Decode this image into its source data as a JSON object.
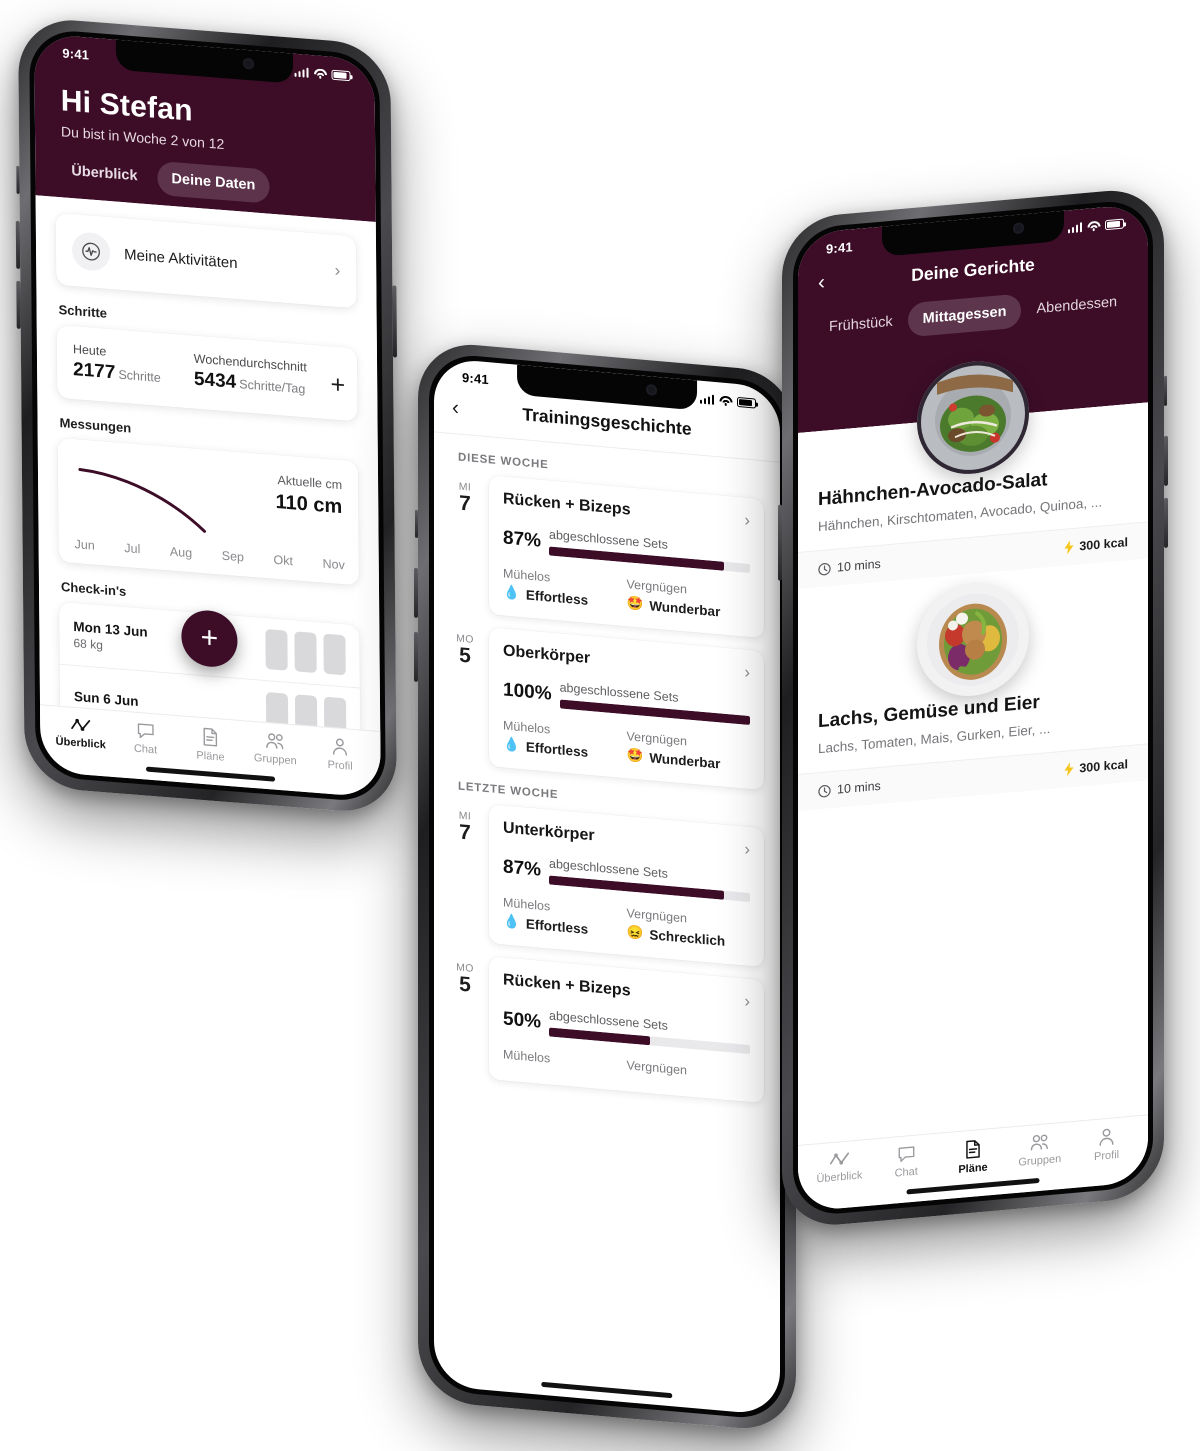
{
  "phone1": {
    "status": {
      "time": "9:41",
      "cellular": "signal-bars",
      "wifi": "wifi-icon",
      "battery": "battery-icon"
    },
    "hero": {
      "greeting": "Hi Stefan",
      "subtitle": "Du bist in Woche 2 von 12",
      "tabs": [
        {
          "label": "Überblick",
          "active": false
        },
        {
          "label": "Deine Daten",
          "active": true
        }
      ]
    },
    "activities": {
      "label": "Meine Aktivitäten",
      "icon": "activity-pulse-icon",
      "chevron": "›"
    },
    "steps": {
      "section_title": "Schritte",
      "today_label": "Heute",
      "today_value": "2177",
      "today_unit": "Schritte",
      "avg_label": "Wochendurchschnitt",
      "avg_value": "5434",
      "avg_unit": "Schritte/Tag",
      "add": "+"
    },
    "measurements": {
      "section_title": "Messungen",
      "current_label": "Aktuelle cm",
      "current_value": "110 cm",
      "months": [
        "Jun",
        "Jul",
        "Aug",
        "Sep",
        "Okt",
        "Nov"
      ]
    },
    "checkins": {
      "section_title": "Check-in's",
      "rows": [
        {
          "date": "Mon 13 Jun",
          "weight": "68 kg"
        },
        {
          "date": "Sun 6 Jun",
          "weight": ""
        }
      ],
      "fab": "+"
    },
    "tabbar": [
      {
        "label": "Überblick",
        "icon": "chart-activity-icon",
        "active": true
      },
      {
        "label": "Chat",
        "icon": "chat-bubble-icon",
        "active": false
      },
      {
        "label": "Pläne",
        "icon": "document-icon",
        "active": false
      },
      {
        "label": "Gruppen",
        "icon": "people-icon",
        "active": false
      },
      {
        "label": "Profil",
        "icon": "person-icon",
        "active": false
      }
    ]
  },
  "phone2": {
    "status": {
      "time": "9:41"
    },
    "nav": {
      "back": "‹",
      "title": "Trainingsgeschichte"
    },
    "groups": [
      {
        "title": "DIESE WOCHE",
        "workouts": [
          {
            "day_abbr": "MI",
            "day_num": "7",
            "name": "Rücken + Bizeps",
            "percent": "87%",
            "percent_value": 87,
            "percent_label": "abgeschlossene Sets",
            "effort_label": "Mühelos",
            "effort_value": "Effortless",
            "effort_icon": "blue-drop-icon",
            "fun_label": "Vergnügen",
            "fun_value": "Wunderbar",
            "fun_icon": "star-struck-emoji",
            "chevron": "›"
          },
          {
            "day_abbr": "MO",
            "day_num": "5",
            "name": "Oberkörper",
            "percent": "100%",
            "percent_value": 100,
            "percent_label": "abgeschlossene Sets",
            "effort_label": "Mühelos",
            "effort_value": "Effortless",
            "effort_icon": "blue-drop-icon",
            "fun_label": "Vergnügen",
            "fun_value": "Wunderbar",
            "fun_icon": "star-struck-emoji",
            "chevron": "›"
          }
        ]
      },
      {
        "title": "LETZTE WOCHE",
        "workouts": [
          {
            "day_abbr": "MI",
            "day_num": "7",
            "name": "Unterkörper",
            "percent": "87%",
            "percent_value": 87,
            "percent_label": "abgeschlossene Sets",
            "effort_label": "Mühelos",
            "effort_value": "Effortless",
            "effort_icon": "blue-drop-icon",
            "fun_label": "Vergnügen",
            "fun_value": "Schrecklich",
            "fun_icon": "confounded-emoji",
            "chevron": "›"
          },
          {
            "day_abbr": "MO",
            "day_num": "5",
            "name": "Rücken + Bizeps",
            "percent": "50%",
            "percent_value": 50,
            "percent_label": "abgeschlossene Sets",
            "effort_label": "Mühelos",
            "effort_value": "",
            "effort_icon": "blue-drop-icon",
            "fun_label": "Vergnügen",
            "fun_value": "",
            "fun_icon": "",
            "chevron": "›"
          }
        ]
      }
    ]
  },
  "phone3": {
    "status": {
      "time": "9:41"
    },
    "nav": {
      "back": "‹",
      "title": "Deine Gerichte"
    },
    "tabs": [
      {
        "label": "Frühstück",
        "active": false
      },
      {
        "label": "Mittagessen",
        "active": true
      },
      {
        "label": "Abendessen",
        "active": false
      }
    ],
    "meals": [
      {
        "title": "Hähnchen-Avocado-Salat",
        "ingredients": "Hähnchen, Kirschtomaten, Avocado, Quinoa, ...",
        "time": "10 mins",
        "calories": "300 kcal",
        "time_icon": "clock-icon",
        "cal_icon": "bolt-icon",
        "photo": "plated-chicken-avocado-salad"
      },
      {
        "title": "Lachs, Gemüse und Eier",
        "ingredients": "Lachs, Tomaten, Mais, Gurken, Eier, ...",
        "time": "10 mins",
        "calories": "300 kcal",
        "time_icon": "clock-icon",
        "cal_icon": "bolt-icon",
        "photo": "salmon-veggie-egg-bowl"
      }
    ],
    "tabbar": [
      {
        "label": "Überblick",
        "icon": "chart-activity-icon",
        "active": false
      },
      {
        "label": "Chat",
        "icon": "chat-bubble-icon",
        "active": false
      },
      {
        "label": "Pläne",
        "icon": "document-icon",
        "active": true
      },
      {
        "label": "Gruppen",
        "icon": "people-icon",
        "active": false
      },
      {
        "label": "Profil",
        "icon": "person-icon",
        "active": false
      }
    ]
  },
  "colors": {
    "brand_burgundy": "#3D0D28",
    "card_white": "#FFFFFF",
    "track_gray": "#E9E9EB",
    "muted_text": "#7A7A7E"
  }
}
